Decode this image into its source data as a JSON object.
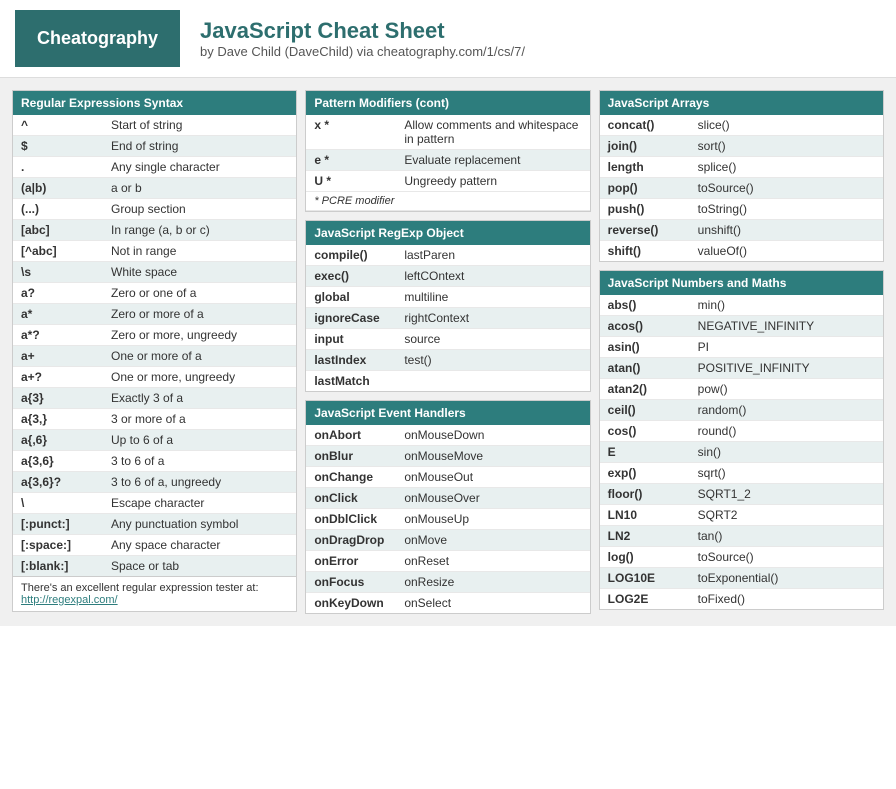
{
  "header": {
    "logo": "Cheatography",
    "title": "JavaScript Cheat Sheet",
    "subtitle": "by Dave Child (DaveChild) via cheatography.com/1/cs/7/"
  },
  "col1": {
    "section1": {
      "title": "Regular Expressions Syntax",
      "rows": [
        {
          "key": "^",
          "val": "Start of string",
          "alt": false
        },
        {
          "key": "$",
          "val": "End of string",
          "alt": true
        },
        {
          "key": ".",
          "val": "Any single character",
          "alt": false
        },
        {
          "key": "(a|b)",
          "val": "a or b",
          "alt": true
        },
        {
          "key": "(...)",
          "val": "Group section",
          "alt": false
        },
        {
          "key": "[abc]",
          "val": "In range (a, b or c)",
          "alt": true
        },
        {
          "key": "[^abc]",
          "val": "Not in range",
          "alt": false
        },
        {
          "key": "\\s",
          "val": "White space",
          "alt": true
        },
        {
          "key": "a?",
          "val": "Zero or one of a",
          "alt": false
        },
        {
          "key": "a*",
          "val": "Zero or more of a",
          "alt": true
        },
        {
          "key": "a*?",
          "val": "Zero or more, ungreedy",
          "alt": false
        },
        {
          "key": "a+",
          "val": "One or more of a",
          "alt": true
        },
        {
          "key": "a+?",
          "val": "One or more, ungreedy",
          "alt": false
        },
        {
          "key": "a{3}",
          "val": "Exactly 3 of a",
          "alt": true
        },
        {
          "key": "a{3,}",
          "val": "3 or more of a",
          "alt": false
        },
        {
          "key": "a{,6}",
          "val": "Up to 6 of a",
          "alt": true
        },
        {
          "key": "a{3,6}",
          "val": "3 to 6 of a",
          "alt": false
        },
        {
          "key": "a{3,6}?",
          "val": "3 to 6 of a, ungreedy",
          "alt": true
        },
        {
          "key": "\\",
          "val": "Escape character",
          "alt": false
        },
        {
          "key": "[:punct:]",
          "val": "Any punctuation symbol",
          "alt": true
        },
        {
          "key": "[:space:]",
          "val": "Any space character",
          "alt": false
        },
        {
          "key": "[:blank:]",
          "val": "Space or tab",
          "alt": true
        }
      ],
      "note": "There's an excellent regular expression tester at: http://regexpal.com/"
    }
  },
  "col2": {
    "section1": {
      "title": "Pattern Modifiers (cont)",
      "rows": [
        {
          "key": "x *",
          "val": "Allow comments and whitespace in pattern",
          "alt": false
        },
        {
          "key": "e *",
          "val": "Evaluate replacement",
          "alt": true
        },
        {
          "key": "U *",
          "val": "Ungreedy pattern",
          "alt": false
        },
        {
          "note": "* PCRE modifier",
          "alt": true
        }
      ]
    },
    "section2": {
      "title": "JavaScript RegExp Object",
      "rows": [
        {
          "key": "compile()",
          "val": "lastParen",
          "alt": false
        },
        {
          "key": "exec()",
          "val": "leftCOntext",
          "alt": true
        },
        {
          "key": "global",
          "val": "multiline",
          "alt": false
        },
        {
          "key": "ignoreCase",
          "val": "rightContext",
          "alt": true
        },
        {
          "key": "input",
          "val": "source",
          "alt": false
        },
        {
          "key": "lastIndex",
          "val": "test()",
          "alt": true
        },
        {
          "key": "lastMatch",
          "val": "",
          "alt": false
        }
      ]
    },
    "section3": {
      "title": "JavaScript Event Handlers",
      "rows": [
        {
          "key": "onAbort",
          "val": "onMouseDown",
          "alt": false
        },
        {
          "key": "onBlur",
          "val": "onMouseMove",
          "alt": true
        },
        {
          "key": "onChange",
          "val": "onMouseOut",
          "alt": false
        },
        {
          "key": "onClick",
          "val": "onMouseOver",
          "alt": true
        },
        {
          "key": "onDblClick",
          "val": "onMouseUp",
          "alt": false
        },
        {
          "key": "onDragDrop",
          "val": "onMove",
          "alt": true
        },
        {
          "key": "onError",
          "val": "onReset",
          "alt": false
        },
        {
          "key": "onFocus",
          "val": "onResize",
          "alt": true
        },
        {
          "key": "onKeyDown",
          "val": "onSelect",
          "alt": false
        }
      ]
    }
  },
  "col3": {
    "section1": {
      "title": "JavaScript Arrays",
      "rows": [
        {
          "key": "concat()",
          "val": "slice()",
          "alt": false
        },
        {
          "key": "join()",
          "val": "sort()",
          "alt": true
        },
        {
          "key": "length",
          "val": "splice()",
          "alt": false
        },
        {
          "key": "pop()",
          "val": "toSource()",
          "alt": true
        },
        {
          "key": "push()",
          "val": "toString()",
          "alt": false
        },
        {
          "key": "reverse()",
          "val": "unshift()",
          "alt": true
        },
        {
          "key": "shift()",
          "val": "valueOf()",
          "alt": false
        }
      ]
    },
    "section2": {
      "title": "JavaScript Numbers and Maths",
      "rows": [
        {
          "key": "abs()",
          "val": "min()",
          "alt": false
        },
        {
          "key": "acos()",
          "val": "NEGATIVE_INFINITY",
          "alt": true
        },
        {
          "key": "asin()",
          "val": "PI",
          "alt": false
        },
        {
          "key": "atan()",
          "val": "POSITIVE_INFINITY",
          "alt": true
        },
        {
          "key": "atan2()",
          "val": "pow()",
          "alt": false
        },
        {
          "key": "ceil()",
          "val": "random()",
          "alt": true
        },
        {
          "key": "cos()",
          "val": "round()",
          "alt": false
        },
        {
          "key": "E",
          "val": "sin()",
          "alt": true
        },
        {
          "key": "exp()",
          "val": "sqrt()",
          "alt": false
        },
        {
          "key": "floor()",
          "val": "SQRT1_2",
          "alt": true
        },
        {
          "key": "LN10",
          "val": "SQRT2",
          "alt": false
        },
        {
          "key": "LN2",
          "val": "tan()",
          "alt": true
        },
        {
          "key": "log()",
          "val": "toSource()",
          "alt": false
        },
        {
          "key": "LOG10E",
          "val": "toExponential()",
          "alt": true
        },
        {
          "key": "LOG2E",
          "val": "toFixed()",
          "alt": false
        }
      ]
    }
  }
}
